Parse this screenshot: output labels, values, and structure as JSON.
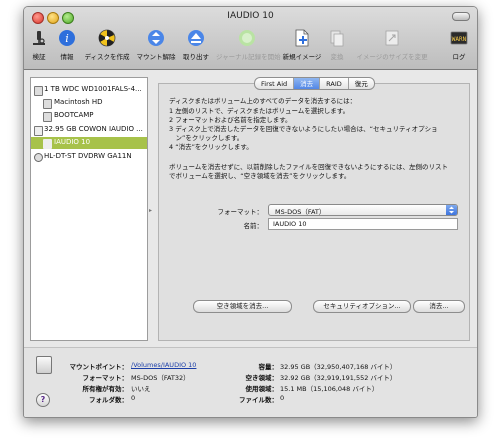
{
  "window": {
    "title": "IAUDIO 10"
  },
  "toolbar": {
    "items": [
      {
        "label": "検証",
        "icon": "microscope-icon",
        "enabled": true
      },
      {
        "label": "情報",
        "icon": "info-icon",
        "enabled": true
      },
      {
        "label": "ディスクを作成",
        "icon": "burn-icon",
        "enabled": true
      },
      {
        "label": "マウント解除",
        "icon": "unmount-icon",
        "enabled": true
      },
      {
        "label": "取り出す",
        "icon": "eject-icon",
        "enabled": true
      },
      {
        "label": "ジャーナル記録を開始",
        "icon": "journal-icon",
        "enabled": false
      },
      {
        "label": "新規イメージ",
        "icon": "new-image-icon",
        "enabled": true
      },
      {
        "label": "変換",
        "icon": "convert-icon",
        "enabled": false
      },
      {
        "label": "イメージのサイズを変更",
        "icon": "resize-image-icon",
        "enabled": false
      },
      {
        "label": "ログ",
        "icon": "log-icon",
        "enabled": true
      }
    ]
  },
  "sidebar": {
    "items": [
      {
        "label": "1 TB WDC WD1001FALS-4...",
        "level": 0,
        "selected": false
      },
      {
        "label": "Macintosh HD",
        "level": 1,
        "selected": false
      },
      {
        "label": "BOOTCAMP",
        "level": 1,
        "selected": false
      },
      {
        "label": "32.95 GB COWON IAUDIO ...",
        "level": 0,
        "selected": false
      },
      {
        "label": "IAUDIO 10",
        "level": 1,
        "selected": true
      },
      {
        "label": "HL-DT-ST DVDRW GA11N",
        "level": 0,
        "selected": false
      }
    ]
  },
  "tabs": [
    {
      "label": "First Aid",
      "active": false
    },
    {
      "label": "消去",
      "active": true
    },
    {
      "label": "RAID",
      "active": false
    },
    {
      "label": "復元",
      "active": false
    }
  ],
  "erase": {
    "intro": "ディスクまたはボリューム上のすべてのデータを消去するには：",
    "steps": [
      "1 左側のリストで、ディスクまたはボリュームを選択します。",
      "2 フォーマットおよび名前を指定します。",
      "3 ディスク上で消去したデータを回復できないようにしたい場合は、“セキュリティオプショ",
      "　ン”をクリックします。",
      "4 “消去”をクリックします。"
    ],
    "note_line1": "ボリュームを消去せずに、以前削除したファイルを回復できないようにするには、左側のリスト",
    "note_line2": "でボリュームを選択し、“空き領域を消去”をクリックします。",
    "format_label": "フォーマット：",
    "format_value": "MS-DOS（FAT）",
    "name_label": "名前：",
    "name_value": "IAUDIO 10",
    "buttons": {
      "erase_free": "空き領域を消去...",
      "security": "セキュリティオプション...",
      "erase": "消去..."
    }
  },
  "info": {
    "mount_point_label": "マウントポイント：",
    "mount_point_value": "/Volumes/IAUDIO 10",
    "format_label": "フォーマット：",
    "format_value": "MS-DOS（FAT32）",
    "owners_label": "所有権が有効：",
    "owners_value": "いいえ",
    "folders_label": "フォルダ数：",
    "folders_value": "0",
    "capacity_label": "容量：",
    "capacity_value": "32.95 GB（32,950,407,168 バイト）",
    "available_label": "空き領域：",
    "available_value": "32.92 GB（32,919,191,552 バイト）",
    "used_label": "使用領域：",
    "used_value": "15.1 MB（15,106,048 バイト）",
    "files_label": "ファイル数：",
    "files_value": "0"
  },
  "colors": {
    "selection": "#a7c24a",
    "active_tab": "#5387e6",
    "link": "#1b3ea8"
  }
}
